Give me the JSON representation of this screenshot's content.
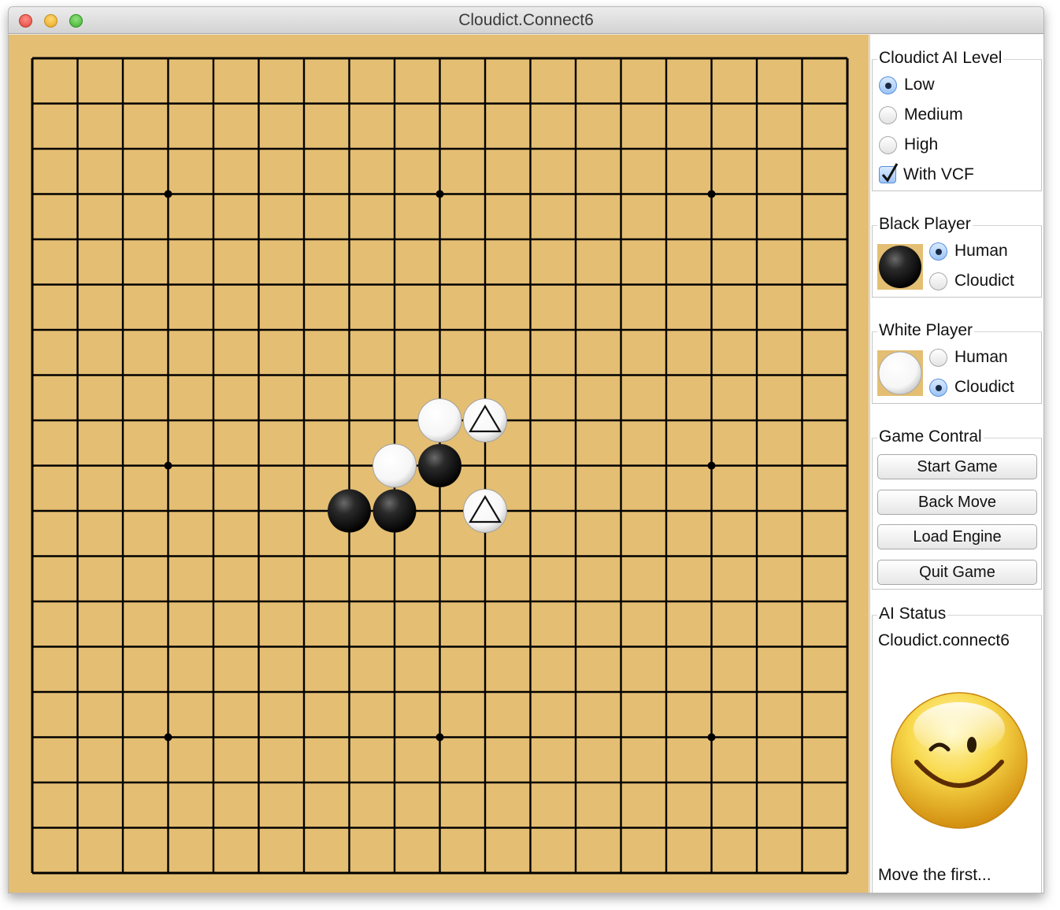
{
  "window": {
    "title": "Cloudict.Connect6"
  },
  "board": {
    "size": 19,
    "star_points": [
      [
        3,
        3
      ],
      [
        9,
        3
      ],
      [
        15,
        3
      ],
      [
        3,
        9
      ],
      [
        15,
        9
      ],
      [
        3,
        15
      ],
      [
        9,
        15
      ],
      [
        15,
        15
      ]
    ],
    "stones": [
      {
        "col": 9,
        "row": 8,
        "color": "white",
        "marker": ""
      },
      {
        "col": 10,
        "row": 8,
        "color": "white",
        "marker": "triangle"
      },
      {
        "col": 8,
        "row": 9,
        "color": "white",
        "marker": ""
      },
      {
        "col": 9,
        "row": 9,
        "color": "black",
        "marker": ""
      },
      {
        "col": 7,
        "row": 10,
        "color": "black",
        "marker": ""
      },
      {
        "col": 8,
        "row": 10,
        "color": "black",
        "marker": ""
      },
      {
        "col": 10,
        "row": 10,
        "color": "white",
        "marker": "triangle"
      }
    ],
    "colors": {
      "wood": "#e4be73",
      "line": "#000000"
    }
  },
  "ai_level": {
    "title": "Cloudict AI Level",
    "options": [
      {
        "label": "Low",
        "selected": true
      },
      {
        "label": "Medium",
        "selected": false
      },
      {
        "label": "High",
        "selected": false
      }
    ],
    "vcf": {
      "label": "With VCF",
      "checked": true
    }
  },
  "black_player": {
    "title": "Black Player",
    "options": [
      {
        "label": "Human",
        "selected": true
      },
      {
        "label": "Cloudict",
        "selected": false
      }
    ]
  },
  "white_player": {
    "title": "White Player",
    "options": [
      {
        "label": "Human",
        "selected": false
      },
      {
        "label": "Cloudict",
        "selected": true
      }
    ]
  },
  "game_control": {
    "title": "Game Contral",
    "buttons": {
      "start": "Start Game",
      "back": "Back Move",
      "load": "Load Engine",
      "quit": "Quit Game"
    }
  },
  "ai_status": {
    "title": "AI Status",
    "engine": "Cloudict.connect6",
    "face_icon": "winking-smiley-icon",
    "message": "Move the first..."
  }
}
